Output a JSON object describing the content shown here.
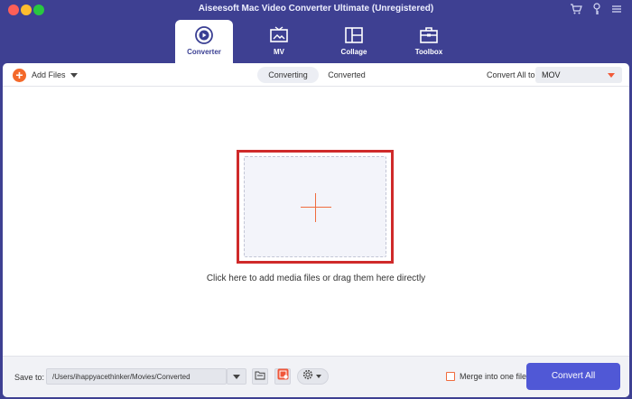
{
  "window": {
    "title": "Aiseesoft Mac Video Converter Ultimate (Unregistered)"
  },
  "nav": {
    "tabs": [
      {
        "label": "Converter",
        "icon": "converter-icon",
        "active": true
      },
      {
        "label": "MV",
        "icon": "tv-icon",
        "active": false
      },
      {
        "label": "Collage",
        "icon": "collage-icon",
        "active": false
      },
      {
        "label": "Toolbox",
        "icon": "toolbox-icon",
        "active": false
      }
    ]
  },
  "toolbar": {
    "add_files_label": "Add Files",
    "segments": [
      {
        "label": "Converting",
        "active": true
      },
      {
        "label": "Converted",
        "active": false
      }
    ],
    "convert_all_label": "Convert All to:",
    "format_value": "MOV"
  },
  "drop": {
    "hint": "Click here to add media files or drag them here directly"
  },
  "bottom": {
    "save_label": "Save to:",
    "save_path": "/Users/ihappyacethinker/Movies/Converted",
    "merge_label": "Merge into one file",
    "merge_checked": false,
    "convert_button": "Convert All"
  },
  "colors": {
    "chrome": "#3e4092",
    "accent_orange": "#f4692a",
    "convert_button": "#5058d6",
    "highlight_border": "#cf2a2a"
  }
}
